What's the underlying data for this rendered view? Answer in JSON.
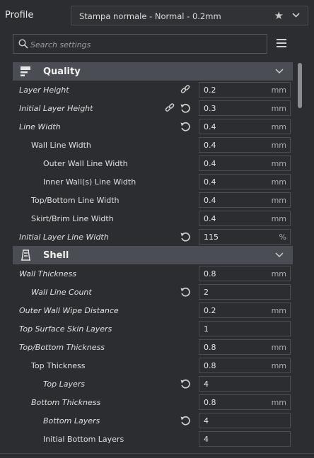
{
  "profile": {
    "label": "Profile",
    "selected": "Stampa normale - Normal - 0.2mm"
  },
  "search": {
    "placeholder": "Search settings"
  },
  "sections": [
    {
      "title": "Quality",
      "icon": "quality-icon",
      "rows": [
        {
          "label": "Layer Height",
          "italic": true,
          "indent": 0,
          "value": "0.2",
          "unit": "mm",
          "icons": [
            "link"
          ]
        },
        {
          "label": "Initial Layer Height",
          "italic": true,
          "indent": 0,
          "value": "0.3",
          "unit": "mm",
          "icons": [
            "link",
            "reset"
          ]
        },
        {
          "label": "Line Width",
          "italic": true,
          "indent": 0,
          "value": "0.4",
          "unit": "mm",
          "icons": [
            "reset"
          ]
        },
        {
          "label": "Wall Line Width",
          "italic": false,
          "indent": 1,
          "value": "0.4",
          "unit": "mm",
          "icons": []
        },
        {
          "label": "Outer Wall Line Width",
          "italic": false,
          "indent": 2,
          "value": "0.4",
          "unit": "mm",
          "icons": []
        },
        {
          "label": "Inner Wall(s) Line Width",
          "italic": false,
          "indent": 2,
          "value": "0.4",
          "unit": "mm",
          "icons": []
        },
        {
          "label": "Top/Bottom Line Width",
          "italic": false,
          "indent": 1,
          "value": "0.4",
          "unit": "mm",
          "icons": []
        },
        {
          "label": "Skirt/Brim Line Width",
          "italic": false,
          "indent": 1,
          "value": "0.4",
          "unit": "mm",
          "icons": []
        },
        {
          "label": "Initial Layer Line Width",
          "italic": true,
          "indent": 0,
          "value": "115",
          "unit": "%",
          "icons": [
            "reset"
          ]
        }
      ]
    },
    {
      "title": "Shell",
      "icon": "shell-icon",
      "rows": [
        {
          "label": "Wall Thickness",
          "italic": true,
          "indent": 0,
          "value": "0.8",
          "unit": "mm",
          "icons": []
        },
        {
          "label": "Wall Line Count",
          "italic": true,
          "indent": 1,
          "value": "2",
          "unit": "",
          "icons": [
            "reset"
          ]
        },
        {
          "label": "Outer Wall Wipe Distance",
          "italic": true,
          "indent": 0,
          "value": "0.2",
          "unit": "mm",
          "icons": []
        },
        {
          "label": "Top Surface Skin Layers",
          "italic": true,
          "indent": 0,
          "value": "1",
          "unit": "",
          "icons": []
        },
        {
          "label": "Top/Bottom Thickness",
          "italic": true,
          "indent": 0,
          "value": "0.8",
          "unit": "mm",
          "icons": []
        },
        {
          "label": "Top Thickness",
          "italic": false,
          "indent": 1,
          "value": "0.8",
          "unit": "mm",
          "icons": []
        },
        {
          "label": "Top Layers",
          "italic": true,
          "indent": 2,
          "value": "4",
          "unit": "",
          "icons": [
            "reset"
          ]
        },
        {
          "label": "Bottom Thickness",
          "italic": true,
          "indent": 1,
          "value": "0.8",
          "unit": "mm",
          "icons": []
        },
        {
          "label": "Bottom Layers",
          "italic": true,
          "indent": 2,
          "value": "4",
          "unit": "",
          "icons": [
            "reset"
          ]
        },
        {
          "label": "Initial Bottom Layers",
          "italic": false,
          "indent": 2,
          "value": "4",
          "unit": "",
          "icons": []
        }
      ]
    }
  ]
}
